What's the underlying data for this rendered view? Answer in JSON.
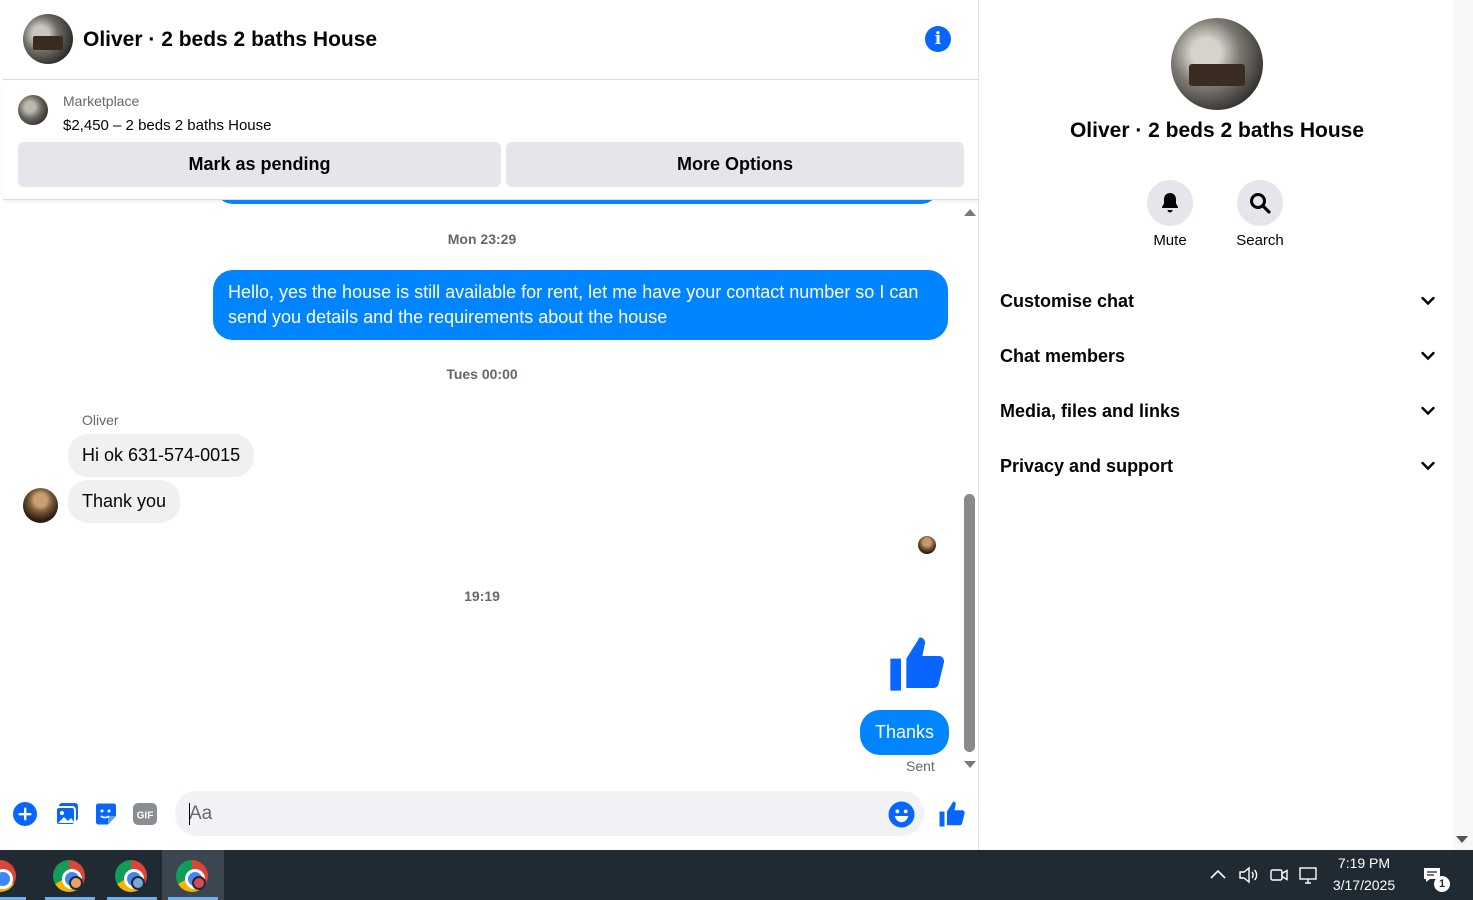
{
  "chat": {
    "title": "Oliver · 2 beds 2 baths House",
    "marketplace": {
      "label": "Marketplace",
      "listing": "$2,450 – 2 beds 2 baths House",
      "pending_button": "Mark as pending",
      "more_button": "More Options"
    },
    "messages": {
      "ts1": "Mon 23:29",
      "out1": "Hello, yes the house is still available for rent, let me have your contact number so I can send you details and the requirements about the house",
      "ts2": "Tues 00:00",
      "sender": "Oliver",
      "in1": "Hi ok 631-574-0015",
      "in2": "Thank you",
      "ts3": "19:19",
      "out2": "Thanks",
      "status": "Sent"
    },
    "composer": {
      "placeholder": "Aa"
    }
  },
  "panel": {
    "title": "Oliver · 2 beds 2 baths House",
    "mute_label": "Mute",
    "search_label": "Search",
    "sections": [
      "Customise chat",
      "Chat members",
      "Media, files and links",
      "Privacy and support"
    ]
  },
  "taskbar": {
    "time": "7:19 PM",
    "date": "3/17/2025",
    "notification_count": "1"
  },
  "colors": {
    "accent": "#0866ff",
    "outgoing_bubble": "#0084ff",
    "incoming_bubble": "#f0f0f0",
    "taskbar": "#1f2a33"
  }
}
